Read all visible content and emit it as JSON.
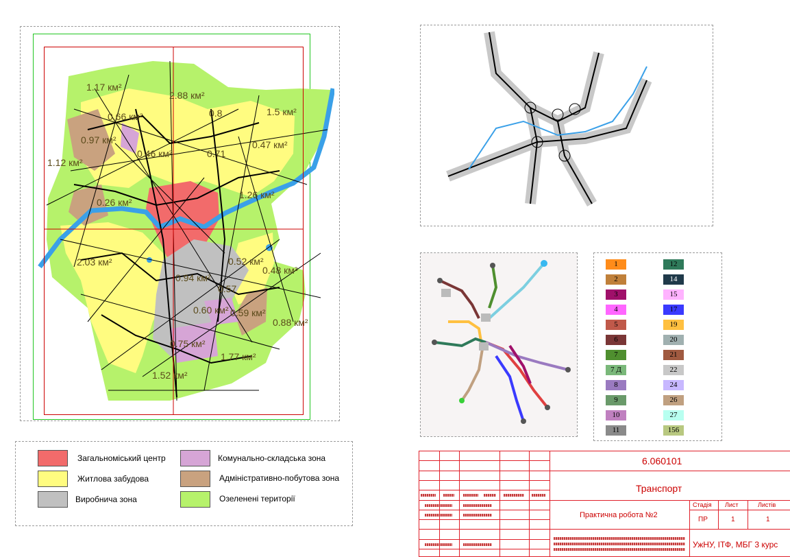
{
  "map": {
    "area_labels": [
      {
        "id": "a1",
        "text": "1.17 км²"
      },
      {
        "id": "a2",
        "text": "2.88 км²"
      },
      {
        "id": "a3",
        "text": "0.66 км²"
      },
      {
        "id": "a4",
        "text": "0.8"
      },
      {
        "id": "a5",
        "text": "1.5 км²"
      },
      {
        "id": "a6",
        "text": "0.97 км²"
      },
      {
        "id": "a7",
        "text": "0.46 км²"
      },
      {
        "id": "a8",
        "text": "0.71"
      },
      {
        "id": "a9",
        "text": "0.47 км²"
      },
      {
        "id": "a10",
        "text": "1.12 км²"
      },
      {
        "id": "a11",
        "text": "0.26 км²"
      },
      {
        "id": "a12",
        "text": "1.26 км²"
      },
      {
        "id": "a13",
        "text": "2.03 км²"
      },
      {
        "id": "a14",
        "text": "0.52 км²"
      },
      {
        "id": "a15",
        "text": "0.48 км²"
      },
      {
        "id": "a16",
        "text": "0.94 км²"
      },
      {
        "id": "a17",
        "text": "0.57"
      },
      {
        "id": "a18",
        "text": "0.60 км²"
      },
      {
        "id": "a19",
        "text": "0.59 км²"
      },
      {
        "id": "a20",
        "text": "0.88 км²"
      },
      {
        "id": "a21",
        "text": "0.75 км²"
      },
      {
        "id": "a22",
        "text": "1.77 км²"
      },
      {
        "id": "a23",
        "text": "1.52 км²"
      }
    ]
  },
  "zones_legend": [
    {
      "label": "Загальноміський центр",
      "color": "#f26b6b"
    },
    {
      "label": "Житлова забудова",
      "color": "#fffc80"
    },
    {
      "label": "Виробнича зона",
      "color": "#c0c0c0"
    },
    {
      "label": "Комунально-складська зона",
      "color": "#d6a5d6"
    },
    {
      "label": "Адміністративно-побутова зона",
      "color": "#c9a27f"
    },
    {
      "label": "Озеленені території",
      "color": "#b6f26b"
    }
  ],
  "routes_legend": [
    {
      "label": "1",
      "color": "#ff8c1a"
    },
    {
      "label": "2",
      "color": "#c0803a"
    },
    {
      "label": "3",
      "color": "#a0106a"
    },
    {
      "label": "4",
      "color": "#ff66ff"
    },
    {
      "label": "5",
      "color": "#c0594a"
    },
    {
      "label": "6",
      "color": "#7a3636"
    },
    {
      "label": "7",
      "color": "#4f8f2f"
    },
    {
      "label": "7 Д",
      "color": "#7ab87a"
    },
    {
      "label": "8",
      "color": "#9a7ac0"
    },
    {
      "label": "9",
      "color": "#6a9a6a"
    },
    {
      "label": "10",
      "color": "#c080c0"
    },
    {
      "label": "11",
      "color": "#8a8a8a"
    },
    {
      "label": "12",
      "color": "#2f7a5a"
    },
    {
      "label": "14",
      "color": "#203a4a"
    },
    {
      "label": "15",
      "color": "#ffb3ff"
    },
    {
      "label": "17",
      "color": "#3a3aff"
    },
    {
      "label": "19",
      "color": "#ffc040"
    },
    {
      "label": "20",
      "color": "#a0b0b0"
    },
    {
      "label": "21",
      "color": "#a05a40"
    },
    {
      "label": "22",
      "color": "#c8c8c8"
    },
    {
      "label": "24",
      "color": "#c8b8ff"
    },
    {
      "label": "26",
      "color": "#c0a080"
    },
    {
      "label": "27",
      "color": "#b8fff0"
    },
    {
      "label": "156",
      "color": "#b8c880"
    }
  ],
  "title_block": {
    "code": "6.060101",
    "title": "Транспорт",
    "work": "Практична робота №2",
    "h_stage": "Стадія",
    "h_sheet": "Лист",
    "h_sheets": "Листів",
    "stage": "ПР",
    "sheet": "1",
    "sheets": "1",
    "org": "УжНУ, ІТФ, МБГ 3 курс"
  }
}
